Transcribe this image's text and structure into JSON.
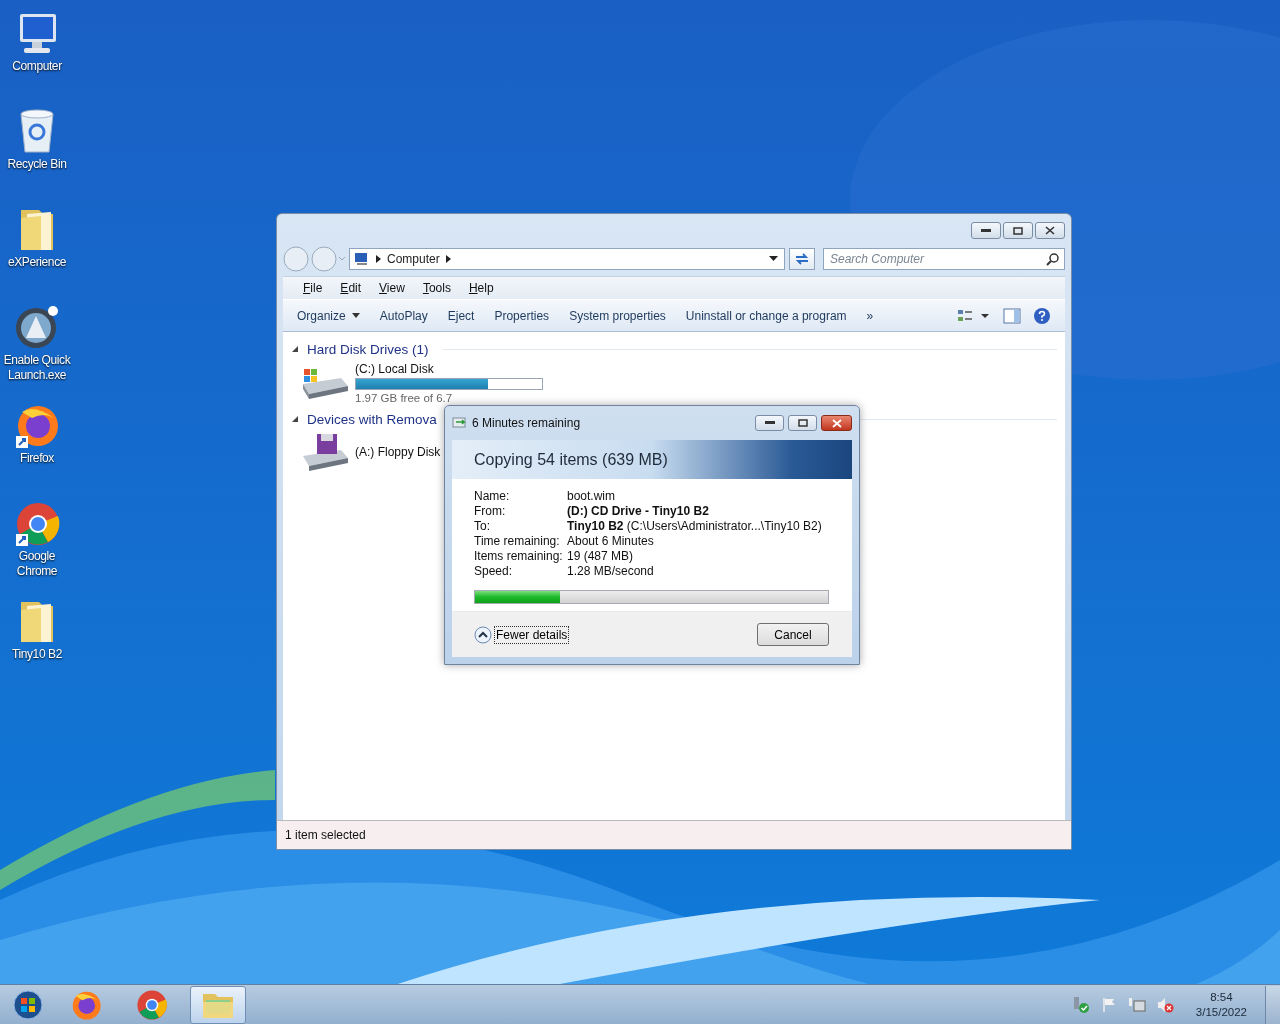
{
  "desktop_icons": [
    {
      "label": "Computer",
      "kind": "computer",
      "shortcut": false
    },
    {
      "label": "Recycle Bin",
      "kind": "recycle",
      "shortcut": false
    },
    {
      "label": "eXPerience",
      "kind": "folder",
      "shortcut": false
    },
    {
      "label": "Enable Quick Launch.exe",
      "kind": "app",
      "shortcut": false
    },
    {
      "label": "Firefox",
      "kind": "firefox",
      "shortcut": true
    },
    {
      "label": "Google Chrome",
      "kind": "chrome",
      "shortcut": true
    },
    {
      "label": "Tiny10 B2",
      "kind": "folder",
      "shortcut": false
    }
  ],
  "explorer": {
    "address": [
      "Computer"
    ],
    "search": {
      "placeholder": "Search Computer"
    },
    "menu": [
      "File",
      "Edit",
      "View",
      "Tools",
      "Help"
    ],
    "toolbar": [
      {
        "label": "Organize",
        "dropdown": true
      },
      {
        "label": "AutoPlay",
        "dropdown": false
      },
      {
        "label": "Eject",
        "dropdown": false
      },
      {
        "label": "Properties",
        "dropdown": false
      },
      {
        "label": "System properties",
        "dropdown": false
      },
      {
        "label": "Uninstall or change a program",
        "dropdown": false
      }
    ],
    "more": "»",
    "groups": [
      {
        "title": "Hard Disk Drives (1)",
        "expanded": true,
        "items": [
          {
            "name": "(C:) Local Disk",
            "kind": "disk",
            "level": 0.71,
            "info": "1.97 GB free of 6.7"
          }
        ]
      },
      {
        "title": "Devices with Remova",
        "expanded": true,
        "items": [
          {
            "name": "(A:) Floppy Disk",
            "kind": "floppy"
          }
        ]
      }
    ],
    "status": "1 item selected"
  },
  "copy_dialog": {
    "title": "6 Minutes remaining",
    "heading": "Copying 54 items (639 MB)",
    "details": [
      {
        "label": "Name:",
        "value": "boot.wim",
        "bold": false
      },
      {
        "label": "From:",
        "value": "(D:) CD Drive - Tiny10 B2",
        "bold": true
      },
      {
        "label": "To:",
        "value": "**Tiny10 B2** (C:\\Users\\Administrator...\\Tiny10 B2)",
        "bold": false
      },
      {
        "label": "Time remaining:",
        "value": "About 6 Minutes",
        "bold": false
      },
      {
        "label": "Items remaining:",
        "value": "19 (487 MB)",
        "bold": false
      },
      {
        "label": "Speed:",
        "value": "1.28 MB/second",
        "bold": false
      }
    ],
    "progress": {
      "level": 0.24
    },
    "toggle": "Fewer details",
    "cancel": "Cancel"
  },
  "taskbar": {
    "items": [
      {
        "kind": "firefox",
        "selected": false
      },
      {
        "kind": "chrome",
        "selected": false
      },
      {
        "kind": "explorer",
        "selected": true
      }
    ],
    "time": "8:54",
    "date": "3/15/2022"
  }
}
